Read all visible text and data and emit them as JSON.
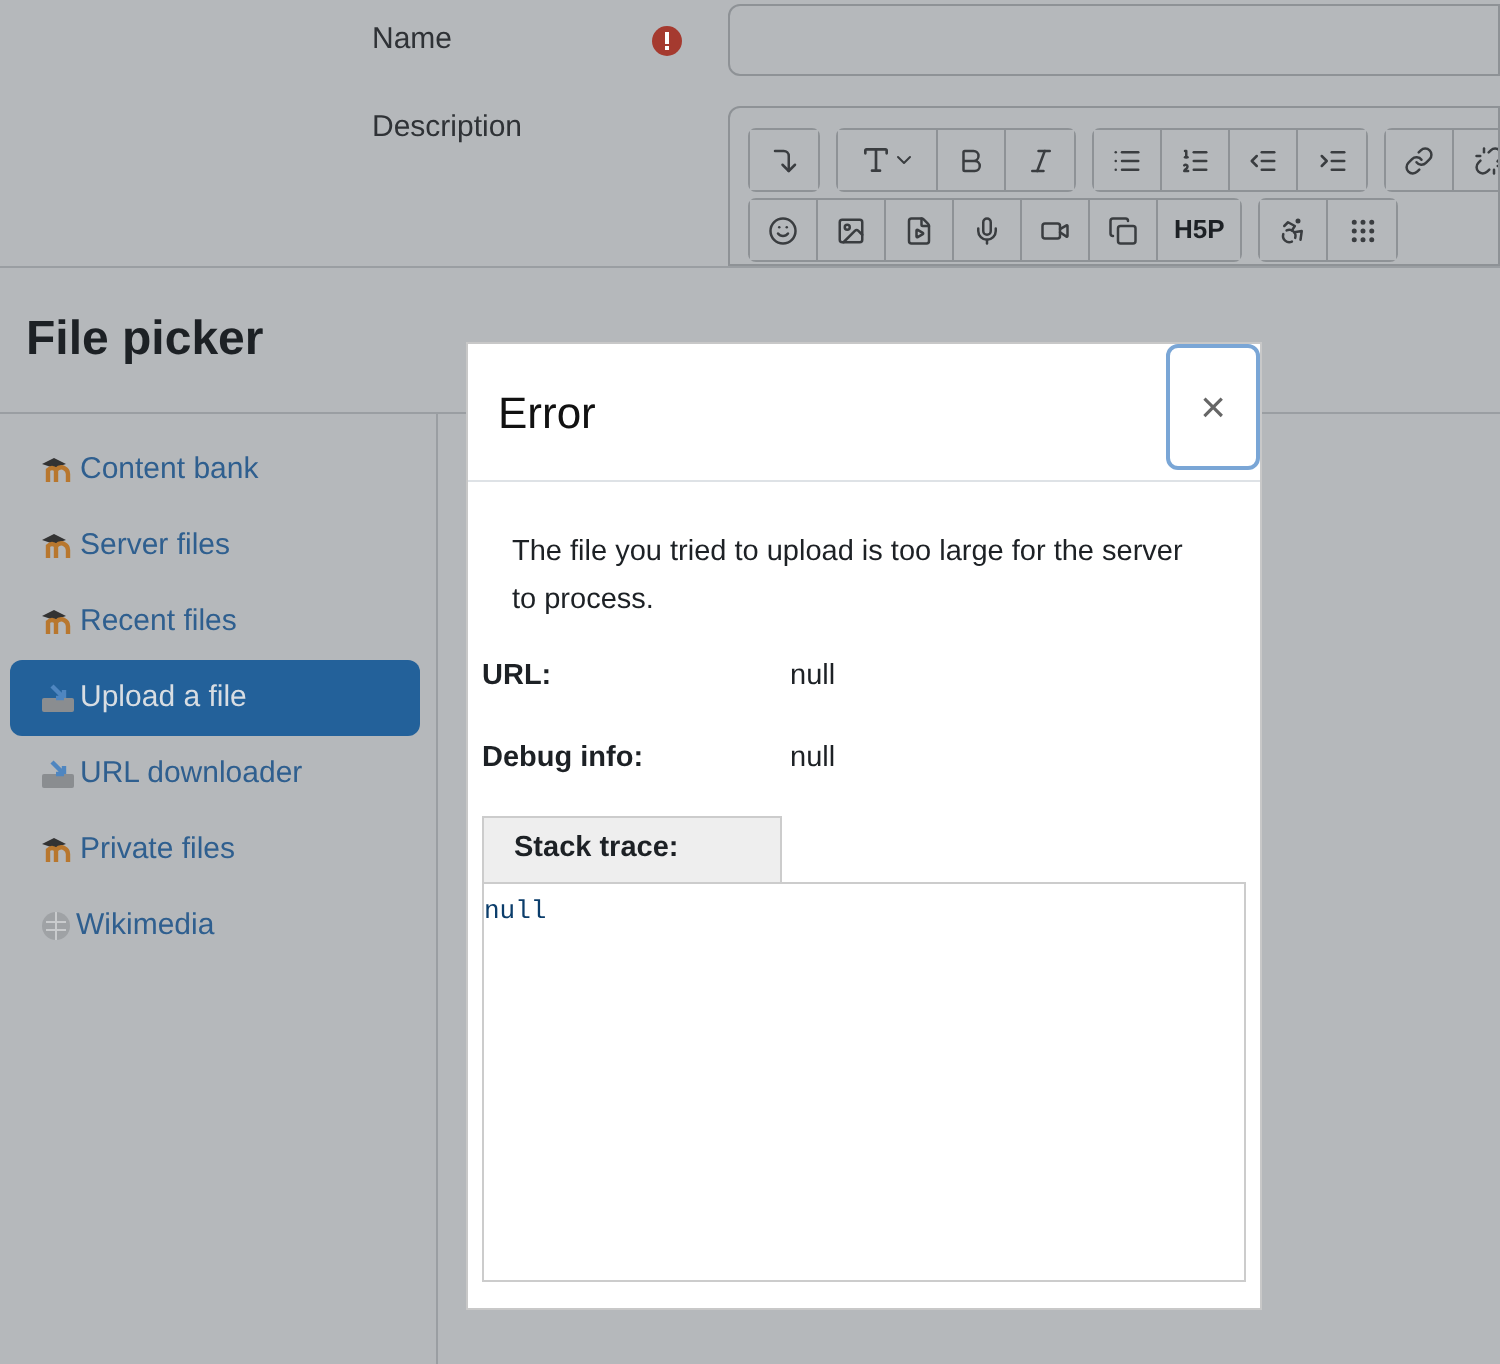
{
  "form": {
    "fields": [
      {
        "label": "Name",
        "required": true
      },
      {
        "label": "Description",
        "required": false
      }
    ],
    "toolbar": [
      [
        {
          "kind": "collapse"
        }
      ],
      [
        {
          "kind": "font"
        },
        {
          "kind": "bold"
        },
        {
          "kind": "italic"
        }
      ],
      [
        {
          "kind": "bullets"
        },
        {
          "kind": "numbers"
        },
        {
          "kind": "outdent"
        },
        {
          "kind": "indent"
        }
      ],
      [
        {
          "kind": "link"
        },
        {
          "kind": "unlink"
        }
      ]
    ],
    "toolbar_row2": [
      [
        {
          "kind": "emoji"
        },
        {
          "kind": "image"
        },
        {
          "kind": "media"
        },
        {
          "kind": "mic"
        },
        {
          "kind": "video"
        },
        {
          "kind": "copy"
        },
        {
          "kind": "h5p",
          "label": "H5P"
        }
      ],
      [
        {
          "kind": "accessibility"
        },
        {
          "kind": "braille"
        }
      ]
    ]
  },
  "file_picker": {
    "title": "File picker",
    "repositories": [
      {
        "label": "Content bank",
        "kind": "moodle",
        "selected": false
      },
      {
        "label": "Server files",
        "kind": "moodle",
        "selected": false
      },
      {
        "label": "Recent files",
        "kind": "moodle",
        "selected": false
      },
      {
        "label": "Upload a file",
        "kind": "upload",
        "selected": true
      },
      {
        "label": "URL downloader",
        "kind": "upload",
        "selected": false
      },
      {
        "label": "Private files",
        "kind": "moodle",
        "selected": false
      },
      {
        "label": "Wikimedia",
        "kind": "wiki",
        "selected": false
      }
    ]
  },
  "error_dialog": {
    "title": "Error",
    "close": "×",
    "message": "The file you tried to upload is too large for the server to process.",
    "details": [
      {
        "label": "URL:",
        "value": "null"
      },
      {
        "label": "Debug info:",
        "value": "null"
      }
    ],
    "stack_trace": {
      "label": "Stack trace:",
      "value": "null"
    }
  }
}
